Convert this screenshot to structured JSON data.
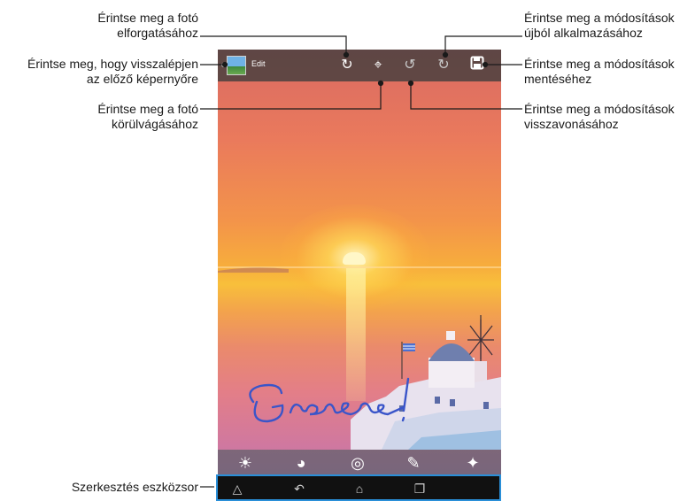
{
  "callouts": {
    "rotate": [
      "Érintse meg a fotó",
      "elforgatásához"
    ],
    "back": [
      "Érintse meg, hogy visszalépjen",
      "az előző képernyőre"
    ],
    "crop": [
      "Érintse meg a fotó",
      "körülvágásához"
    ],
    "redo": [
      "Érintse meg a módosítások",
      "újból alkalmazásához"
    ],
    "save": [
      "Érintse meg a módosítások",
      "mentéséhez"
    ],
    "undo": [
      "Érintse meg a módosítások",
      "visszavonásához"
    ],
    "edit_toolbar": "Szerkesztés eszközsor"
  },
  "topbar": {
    "title": "Edit"
  },
  "colors": {
    "callout_line": "#1a1a1a",
    "highlight_frame": "#2a8fd8"
  }
}
